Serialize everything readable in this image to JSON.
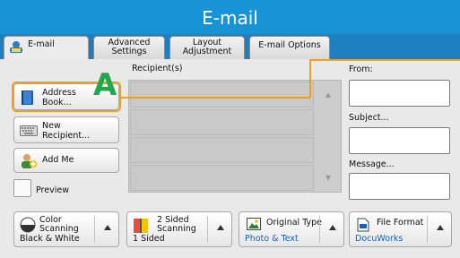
{
  "window": {
    "title": "E-mail"
  },
  "tabs": [
    {
      "label": "E-mail"
    },
    {
      "label": "Advanced\nSettings"
    },
    {
      "label": "Layout\nAdjustment"
    },
    {
      "label": "E-mail Options"
    }
  ],
  "recipients": {
    "heading": "Recipient(s)"
  },
  "left_buttons": {
    "address_book": "Address\nBook...",
    "new_recipient": "New\nRecipient...",
    "add_me": "Add Me",
    "preview": "Preview"
  },
  "fields": {
    "from_label": "From:",
    "subject_label": "Subject...",
    "message_label": "Message...",
    "from_value": "",
    "subject_value": "",
    "message_value": ""
  },
  "bottom_buttons": {
    "color_scanning": {
      "label": "Color\nScanning",
      "value": "Black & White"
    },
    "two_sided": {
      "label": "2 Sided\nScanning",
      "value": "1 Sided"
    },
    "original_type": {
      "label": "Original Type",
      "value": "Photo & Text"
    },
    "file_format": {
      "label": "File Format",
      "value": "DocuWorks"
    }
  },
  "annotation": {
    "marker": "A"
  },
  "colors": {
    "title_bar": "#1793d6",
    "tab_strip": "#1d7fbe",
    "highlight": "#f0a020",
    "marker": "#1fa84c",
    "value_blue": "#1a5fb4"
  }
}
